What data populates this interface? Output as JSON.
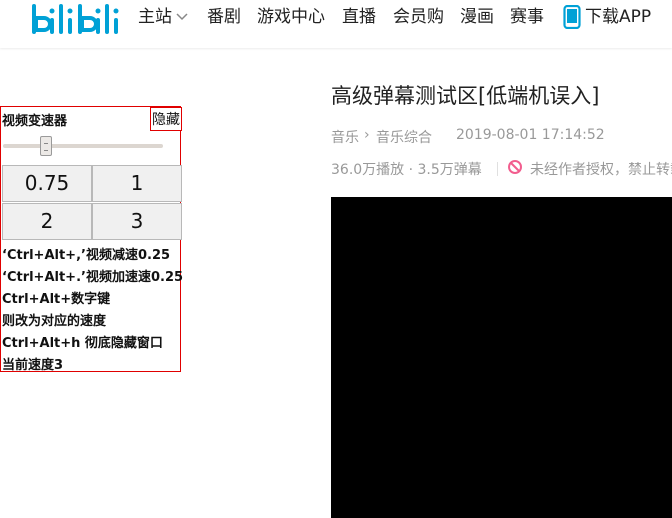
{
  "colors": {
    "brand": "#00a1d6",
    "panel_border": "#e00000",
    "ban_icon": "#f25d8e",
    "player_bg": "#000000"
  },
  "nav": {
    "logo_icon": "bilibili-logo",
    "items": [
      {
        "label": "主站"
      },
      {
        "label": "番剧"
      },
      {
        "label": "游戏中心"
      },
      {
        "label": "直播"
      },
      {
        "label": "会员购"
      },
      {
        "label": "漫画"
      },
      {
        "label": "赛事"
      },
      {
        "label": "下载APP"
      }
    ]
  },
  "speed_panel": {
    "title": "视频变速器",
    "hide_label": "隐藏",
    "slider_level": 0.25,
    "buttons": [
      "0.75",
      "1",
      "2",
      "3"
    ],
    "hints": [
      "‘Ctrl+Alt+,’视频减速0.25",
      "‘Ctrl+Alt+.’视频加速速0.25",
      "Ctrl+Alt+数字键",
      "则改为对应的速度",
      "Ctrl+Alt+h 彻底隐藏窗口",
      "当前速度3"
    ]
  },
  "video": {
    "title": "高级弹幕测试区[低端机误入]",
    "breadcrumb": [
      "音乐",
      "音乐综合"
    ],
    "breadcrumb_sep": "›",
    "pubdate": "2019-08-01 17:14:52",
    "stats": "36.0万播放 · 3.5万弹幕",
    "copyright": "未经作者授权，禁止转载"
  }
}
